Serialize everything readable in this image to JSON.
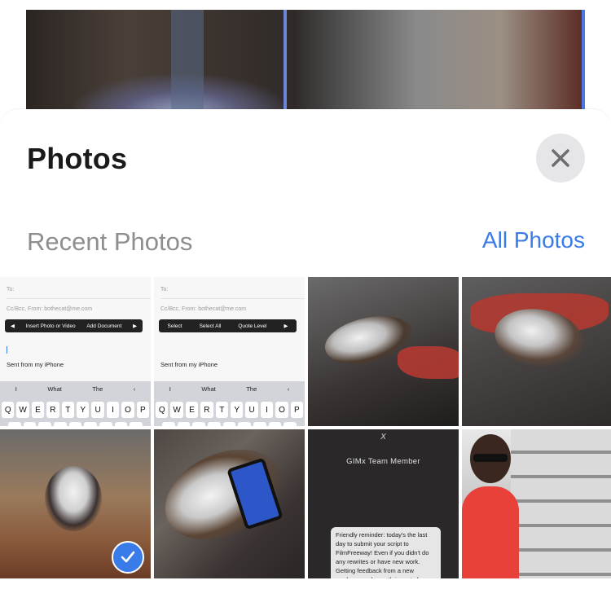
{
  "background_photo": {
    "description": ""
  },
  "sheet": {
    "title": "Photos",
    "close_icon": "close-icon",
    "section_label": "Recent Photos",
    "all_photos_label": "All Photos",
    "accent_color": "#3a7bea"
  },
  "thumbnails": [
    {
      "type": "email-screenshot",
      "to_label": "To:",
      "cc_label": "Cc/Bcc, From: bothecat@me.com",
      "menu": [
        "Insert Photo or Video",
        "Add Document"
      ],
      "sent": "Sent from my iPhone",
      "suggestions": [
        "I",
        "What",
        "The"
      ],
      "keys": [
        "Q",
        "W",
        "E",
        "R",
        "T",
        "Y",
        "U",
        "I",
        "O",
        "P"
      ],
      "selected": false
    },
    {
      "type": "email-screenshot",
      "to_label": "To:",
      "cc_label": "Cc/Bcc, From: bothecat@me.com",
      "menu": [
        "Select",
        "Select All",
        "Quote Level"
      ],
      "sent": "Sent from my iPhone",
      "suggestions": [
        "I",
        "What",
        "The"
      ],
      "keys": [
        "Q",
        "W",
        "E",
        "R",
        "T",
        "Y",
        "U",
        "I",
        "O",
        "P"
      ],
      "selected": false
    },
    {
      "type": "photo",
      "selected": false
    },
    {
      "type": "photo",
      "selected": false
    },
    {
      "type": "photo",
      "selected": true
    },
    {
      "type": "photo",
      "selected": false
    },
    {
      "type": "card",
      "logo": "X",
      "title": "GIMx Team Member",
      "message": "Friendly reminder: today's the last day to submit your script to FilmFreeway! Even if you didn't do any rewrites or have new work. Getting feedback from a new producer each month is part of your membership benefits, so we",
      "selected": false
    },
    {
      "type": "photo",
      "selected": false
    }
  ]
}
